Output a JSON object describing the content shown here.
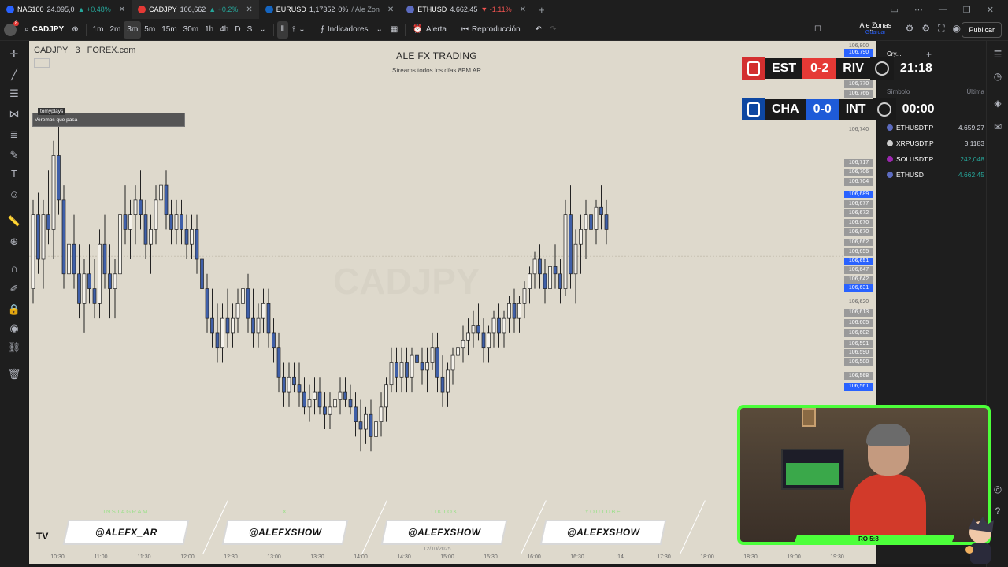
{
  "tabs": [
    {
      "symbol": "NAS100",
      "price": "24.095,0",
      "change": "+0.48%",
      "dir": "up",
      "color": "#2962ff"
    },
    {
      "symbol": "CADJPY",
      "price": "106,662",
      "change": "+0.2%",
      "dir": "up",
      "color": "#e53935"
    },
    {
      "symbol": "EURUSD",
      "price": "1,17352",
      "change": "0%",
      "extra": "Ale Zon",
      "dir": "flat",
      "color": "#1565c0"
    },
    {
      "symbol": "ETHUSD",
      "price": "4.662,45",
      "change": "-1.11%",
      "dir": "down",
      "color": "#5c6bc0"
    }
  ],
  "toolbar": {
    "symbol": "CADJPY",
    "intervals": [
      "1m",
      "2m",
      "3m",
      "5m",
      "15m",
      "30m",
      "1h",
      "4h",
      "D",
      "S"
    ],
    "selected_interval": "3m",
    "indicators": "Indicadores",
    "alert": "Alerta",
    "replay": "Reproducción",
    "user_name": "Ale Zonas",
    "user_sub": "Guardar",
    "publish": "Publicar",
    "notification_count": "8"
  },
  "chart": {
    "symbol": "CADJPY",
    "interval": "3",
    "exchange": "FOREX.com",
    "overlay_title": "ALE FX TRADING",
    "overlay_subtitle": "Streams todos los días 8PM AR",
    "watermark": "CADJPY",
    "chat_user": "tomyplays",
    "chat_message": "Veremos que pasa",
    "time_labels": [
      "10:30",
      "11:00",
      "11:30",
      "12:00",
      "12:30",
      "13:00",
      "13:30",
      "14:00",
      "14:30",
      "15:00",
      "15:30",
      "16:00",
      "16:30",
      "14",
      "17:30",
      "18:00",
      "18:30",
      "19:00",
      "19:30"
    ],
    "date_label": "12/10/2025"
  },
  "price_labels": [
    {
      "v": "106,800",
      "style": "plain"
    },
    {
      "v": "106,790",
      "style": "blue"
    },
    {
      "v": "106,770",
      "style": "grey"
    },
    {
      "v": "106,766",
      "style": "grey"
    },
    {
      "v": "106,740",
      "style": "plain"
    },
    {
      "v": "106,717",
      "style": "grey"
    },
    {
      "v": "106,706",
      "style": "grey"
    },
    {
      "v": "106,704",
      "style": "grey"
    },
    {
      "v": "106,689",
      "style": "blue"
    },
    {
      "v": "106,677",
      "style": "grey"
    },
    {
      "v": "106,672",
      "style": "grey"
    },
    {
      "v": "106,670",
      "style": "grey"
    },
    {
      "v": "106,670",
      "style": "grey"
    },
    {
      "v": "106,662",
      "style": "grey"
    },
    {
      "v": "106,655",
      "style": "grey"
    },
    {
      "v": "106,651",
      "style": "blue"
    },
    {
      "v": "106,647",
      "style": "grey"
    },
    {
      "v": "106,642",
      "style": "grey"
    },
    {
      "v": "106,631",
      "style": "blue"
    },
    {
      "v": "106,620",
      "style": "plain"
    },
    {
      "v": "106,613",
      "style": "grey"
    },
    {
      "v": "106,605",
      "style": "grey"
    },
    {
      "v": "106,602",
      "style": "grey"
    },
    {
      "v": "106,591",
      "style": "grey"
    },
    {
      "v": "106,590",
      "style": "grey"
    },
    {
      "v": "106,588",
      "style": "grey"
    },
    {
      "v": "106,568",
      "style": "grey"
    },
    {
      "v": "106,561",
      "style": "blue"
    }
  ],
  "socials": [
    {
      "label": "INSTAGRAM",
      "handle": "@ALEFX_AR"
    },
    {
      "label": "X",
      "handle": "@ALEFXSHOW"
    },
    {
      "label": "TIKTOK",
      "handle": "@ALEFXSHOW"
    },
    {
      "label": "YOUTUBE",
      "handle": "@ALEFXSHOW"
    }
  ],
  "watchlist": {
    "header_symbol": "Símbolo",
    "header_last": "Última",
    "list_name": "Cry...",
    "rows": [
      {
        "symbol": "ETHUSDT.P",
        "last": "4.659,27",
        "color": "#5c6bc0",
        "trend": "down"
      },
      {
        "symbol": "XRPUSDT.P",
        "last": "3,1183",
        "color": "#cccccc",
        "trend": "down"
      },
      {
        "symbol": "SOLUSDT.P",
        "last": "242,048",
        "color": "#9c27b0",
        "trend": "up"
      },
      {
        "symbol": "ETHUSD",
        "last": "4.662,45",
        "color": "#5c6bc0",
        "trend": "up"
      }
    ]
  },
  "scores": [
    {
      "home": "EST",
      "score": "0-2",
      "away": "RIV",
      "time": "21:18",
      "home_color": "#d32f2f",
      "score_color": "#e53935"
    },
    {
      "home": "CHA",
      "score": "0-0",
      "away": "INT",
      "time": "00:00",
      "home_color": "#0d47a1",
      "score_color": "#1e5bd8"
    }
  ],
  "webcam": {
    "bar_label": "RO 5:8",
    "border_color": "#4cff3a"
  },
  "candles": [
    [
      106.64,
      106.7,
      106.63,
      106.69
    ],
    [
      106.69,
      106.705,
      106.65,
      106.66
    ],
    [
      106.66,
      106.7,
      106.64,
      106.69
    ],
    [
      106.69,
      106.72,
      106.67,
      106.68
    ],
    [
      106.68,
      106.74,
      106.66,
      106.73
    ],
    [
      106.73,
      106.75,
      106.69,
      106.7
    ],
    [
      106.7,
      106.71,
      106.64,
      106.65
    ],
    [
      106.65,
      106.68,
      106.62,
      106.67
    ],
    [
      106.67,
      106.69,
      106.64,
      106.65
    ],
    [
      106.65,
      106.67,
      106.62,
      106.63
    ],
    [
      106.63,
      106.66,
      106.61,
      106.65
    ],
    [
      106.65,
      106.67,
      106.63,
      106.64
    ],
    [
      106.64,
      106.66,
      106.62,
      106.63
    ],
    [
      106.63,
      106.68,
      106.62,
      106.67
    ],
    [
      106.67,
      106.69,
      106.64,
      106.65
    ],
    [
      106.65,
      106.67,
      106.62,
      106.64
    ],
    [
      106.64,
      106.66,
      106.62,
      106.65
    ],
    [
      106.65,
      106.7,
      106.64,
      106.69
    ],
    [
      106.69,
      106.71,
      106.67,
      106.68
    ],
    [
      106.68,
      106.7,
      106.66,
      106.69
    ],
    [
      106.69,
      106.71,
      106.67,
      106.7
    ],
    [
      106.7,
      106.72,
      106.68,
      106.69
    ],
    [
      106.69,
      106.7,
      106.66,
      106.67
    ],
    [
      106.67,
      106.69,
      106.65,
      106.68
    ],
    [
      106.68,
      106.71,
      106.67,
      106.7
    ],
    [
      106.7,
      106.72,
      106.68,
      106.71
    ],
    [
      106.71,
      106.72,
      106.68,
      106.69
    ],
    [
      106.69,
      106.7,
      106.67,
      106.68
    ],
    [
      106.68,
      106.7,
      106.67,
      106.69
    ],
    [
      106.69,
      106.7,
      106.67,
      106.68
    ],
    [
      106.68,
      106.69,
      106.66,
      106.67
    ],
    [
      106.67,
      106.69,
      106.66,
      106.68
    ],
    [
      106.68,
      106.69,
      106.65,
      106.66
    ],
    [
      106.66,
      106.67,
      106.63,
      106.64
    ],
    [
      106.64,
      106.65,
      106.61,
      106.62
    ],
    [
      106.62,
      106.64,
      106.6,
      106.61
    ],
    [
      106.61,
      106.63,
      106.59,
      106.6
    ],
    [
      106.6,
      106.63,
      106.59,
      106.62
    ],
    [
      106.62,
      106.64,
      106.6,
      106.61
    ],
    [
      106.61,
      106.63,
      106.6,
      106.62
    ],
    [
      106.62,
      106.64,
      106.61,
      106.63
    ],
    [
      106.63,
      106.65,
      106.62,
      106.64
    ],
    [
      106.64,
      106.65,
      106.61,
      106.62
    ],
    [
      106.62,
      106.64,
      106.6,
      106.61
    ],
    [
      106.61,
      106.63,
      106.6,
      106.62
    ],
    [
      106.62,
      106.64,
      106.61,
      106.63
    ],
    [
      106.63,
      106.64,
      106.6,
      106.61
    ],
    [
      106.61,
      106.62,
      106.59,
      106.6
    ],
    [
      106.6,
      106.61,
      106.57,
      106.58
    ],
    [
      106.58,
      106.59,
      106.56,
      106.57
    ],
    [
      106.57,
      106.59,
      106.56,
      106.58
    ],
    [
      106.58,
      106.59,
      106.57,
      106.575
    ],
    [
      106.575,
      106.59,
      106.56,
      106.57
    ],
    [
      106.57,
      106.58,
      106.555,
      106.56
    ],
    [
      106.56,
      106.575,
      106.55,
      106.565
    ],
    [
      106.565,
      106.58,
      106.555,
      106.57
    ],
    [
      106.57,
      106.58,
      106.555,
      106.56
    ],
    [
      106.56,
      106.57,
      106.545,
      106.555
    ],
    [
      106.555,
      106.57,
      106.545,
      106.56
    ],
    [
      106.56,
      106.575,
      106.55,
      106.565
    ],
    [
      106.565,
      106.58,
      106.555,
      106.57
    ],
    [
      106.57,
      106.58,
      106.56,
      106.565
    ],
    [
      106.565,
      106.575,
      106.555,
      106.56
    ],
    [
      106.56,
      106.57,
      106.54,
      106.55
    ],
    [
      106.55,
      106.565,
      106.53,
      106.545
    ],
    [
      106.545,
      106.56,
      106.535,
      106.555
    ],
    [
      106.555,
      106.565,
      106.53,
      106.54
    ],
    [
      106.54,
      106.56,
      106.53,
      106.55
    ],
    [
      106.55,
      106.57,
      106.54,
      106.56
    ],
    [
      106.56,
      106.58,
      106.55,
      106.575
    ],
    [
      106.575,
      106.6,
      106.57,
      106.59
    ],
    [
      106.59,
      106.6,
      106.57,
      106.58
    ],
    [
      106.58,
      106.6,
      106.57,
      106.59
    ],
    [
      106.59,
      106.6,
      106.57,
      106.58
    ],
    [
      106.58,
      106.6,
      106.57,
      106.595
    ],
    [
      106.595,
      106.605,
      106.58,
      106.59
    ],
    [
      106.59,
      106.6,
      106.575,
      106.585
    ],
    [
      106.585,
      106.6,
      106.57,
      106.59
    ],
    [
      106.59,
      106.61,
      106.585,
      106.6
    ],
    [
      106.6,
      106.61,
      106.57,
      106.58
    ],
    [
      106.58,
      106.595,
      106.56,
      106.57
    ],
    [
      106.57,
      106.59,
      106.56,
      106.585
    ],
    [
      106.585,
      106.6,
      106.575,
      106.595
    ],
    [
      106.595,
      106.61,
      106.585,
      106.6
    ],
    [
      106.6,
      106.615,
      106.59,
      106.605
    ],
    [
      106.605,
      106.62,
      106.595,
      106.61
    ],
    [
      106.61,
      106.625,
      106.6,
      106.615
    ],
    [
      106.615,
      106.63,
      106.605,
      106.61
    ],
    [
      106.61,
      106.62,
      106.59,
      106.6
    ],
    [
      106.6,
      106.615,
      106.59,
      106.61
    ],
    [
      106.61,
      106.625,
      106.6,
      106.62
    ],
    [
      106.62,
      106.63,
      106.6,
      106.61
    ],
    [
      106.61,
      106.625,
      106.6,
      106.62
    ],
    [
      106.62,
      106.635,
      106.61,
      106.63
    ],
    [
      106.63,
      106.64,
      106.61,
      106.62
    ],
    [
      106.62,
      106.635,
      106.61,
      106.63
    ],
    [
      106.63,
      106.645,
      106.62,
      106.64
    ],
    [
      106.64,
      106.655,
      106.63,
      106.65
    ],
    [
      106.65,
      106.665,
      106.64,
      106.66
    ],
    [
      106.66,
      106.67,
      106.64,
      106.65
    ],
    [
      106.65,
      106.66,
      106.63,
      106.64
    ],
    [
      106.64,
      106.66,
      106.63,
      106.655
    ],
    [
      106.655,
      106.67,
      106.64,
      106.65
    ],
    [
      106.65,
      106.66,
      106.63,
      106.64
    ],
    [
      106.64,
      106.7,
      106.635,
      106.69
    ],
    [
      106.69,
      106.71,
      106.64,
      106.65
    ],
    [
      106.65,
      106.68,
      106.63,
      106.67
    ],
    [
      106.67,
      106.69,
      106.65,
      106.68
    ],
    [
      106.68,
      106.7,
      106.66,
      106.69
    ],
    [
      106.69,
      106.705,
      106.67,
      106.68
    ],
    [
      106.68,
      106.7,
      106.67,
      106.695
    ],
    [
      106.695,
      106.71,
      106.68,
      106.69
    ],
    [
      106.69,
      106.7,
      106.67,
      106.68
    ]
  ]
}
